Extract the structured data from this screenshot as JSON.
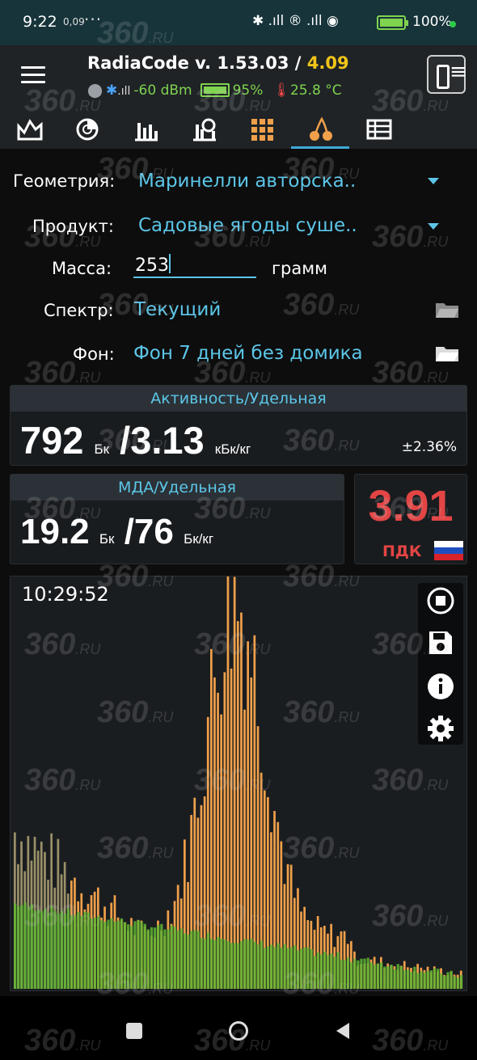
{
  "status_bar": {
    "time": "9:22",
    "small_text": "0,09",
    "dots": "···",
    "icons": "✱ .ıll ® .ıll ◉",
    "battery_pct": "100%"
  },
  "header": {
    "app_title": "RadiaCode v. 1.53.03 /",
    "app_version_secondary": "4.09",
    "signal_dbm": "-60 dBm",
    "device_battery": "95%",
    "temperature": "25.8 °C"
  },
  "tabs": [
    {
      "icon": "area-chart-icon"
    },
    {
      "icon": "radar-icon"
    },
    {
      "icon": "bar-chart-icon"
    },
    {
      "icon": "dose-bar-icon"
    },
    {
      "icon": "grid-icon"
    },
    {
      "icon": "cherry-icon",
      "active": true
    },
    {
      "icon": "table-icon"
    }
  ],
  "form": {
    "geometry_label": "Геометрия:",
    "geometry_value": "Маринелли авторска..",
    "product_label": "Продукт:",
    "product_value": "Садовые ягоды суше..",
    "mass_label": "Масса:",
    "mass_value": "253",
    "mass_unit": "грамм",
    "spectrum_label": "Спектр:",
    "spectrum_value": "Текущий",
    "background_label": "Фон:",
    "background_value": "Фон 7 дней без домика"
  },
  "activity": {
    "header": "Активность/Удельная",
    "value": "792",
    "unit": "Бк",
    "specific": "/3.13",
    "specific_unit": "кБк/кг",
    "error": "±2.36%"
  },
  "mda": {
    "header": "МДА/Удельная",
    "value": "19.2",
    "unit": "Бк",
    "specific": "/76",
    "specific_unit": "Бк/кг"
  },
  "pdk": {
    "value": "3.91",
    "label": "ПДК"
  },
  "spectrum": {
    "time": "10:29:52"
  },
  "watermark": {
    "number": "360",
    "suffix": ".RU"
  },
  "colors": {
    "accent": "#5cc6e8",
    "current_spectrum": "#f0a04a",
    "background_spectrum": "#5fb533",
    "danger": "#e34545"
  }
}
